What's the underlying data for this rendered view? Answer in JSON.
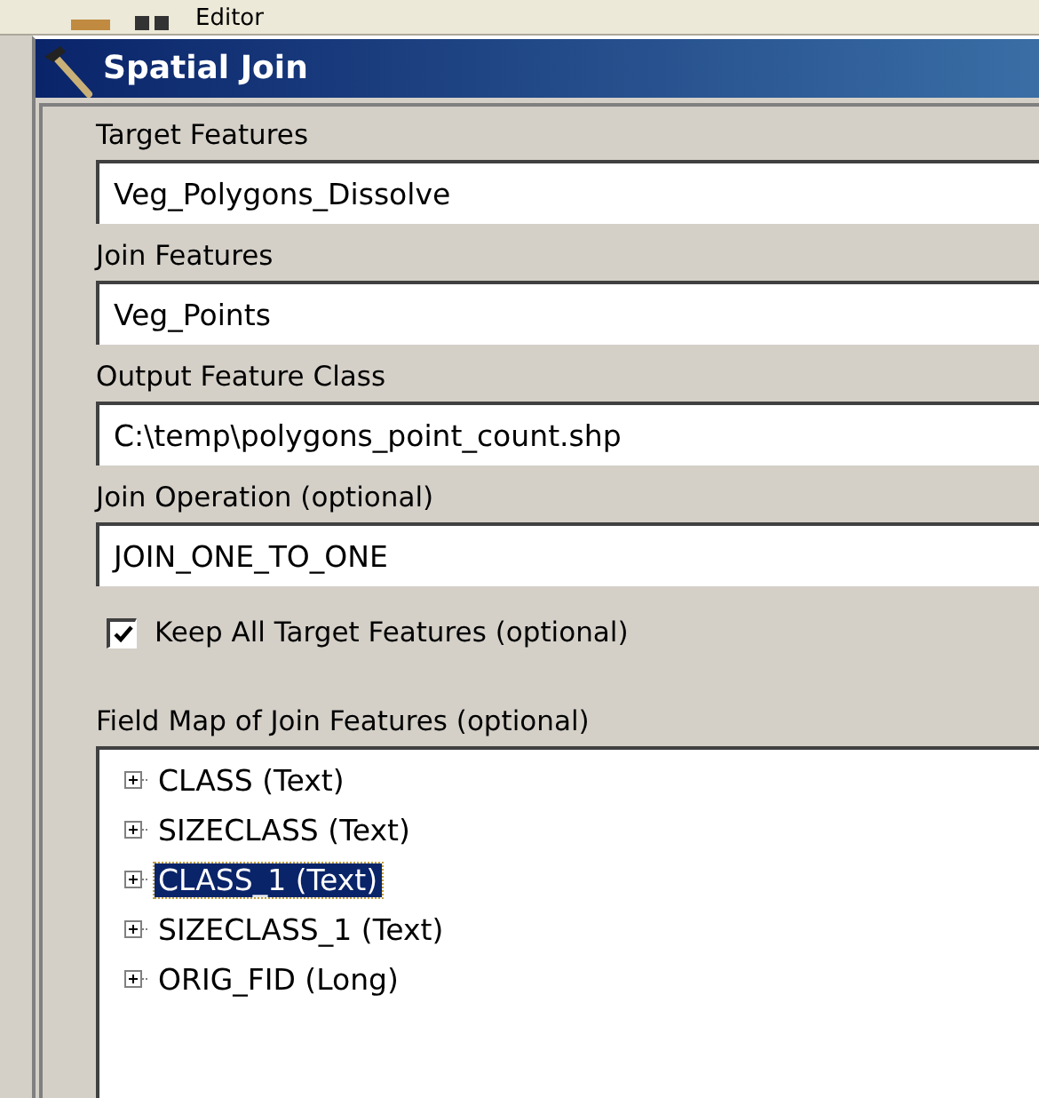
{
  "toolbar": {
    "label": "Editor"
  },
  "window": {
    "title": "Spatial Join"
  },
  "fields": [
    {
      "label": "Target Features",
      "value": "Veg_Polygons_Dissolve"
    },
    {
      "label": "Join Features",
      "value": "Veg_Points"
    },
    {
      "label": "Output Feature Class",
      "value": "C:\\temp\\polygons_point_count.shp"
    },
    {
      "label": "Join Operation (optional)",
      "value": "JOIN_ONE_TO_ONE"
    }
  ],
  "checkbox": {
    "label": "Keep All Target Features (optional)",
    "checked": true
  },
  "field_map": {
    "label": "Field Map of Join Features (optional)",
    "items": [
      {
        "label": "CLASS (Text)",
        "selected": false,
        "expanded": false
      },
      {
        "label": "SIZECLASS (Text)",
        "selected": false,
        "expanded": false
      },
      {
        "label": "CLASS_1 (Text)",
        "selected": true,
        "expanded": false
      },
      {
        "label": "SIZECLASS_1 (Text)",
        "selected": false,
        "expanded": false
      },
      {
        "label": "ORIG_FID (Long)",
        "selected": false,
        "expanded": false
      }
    ]
  }
}
